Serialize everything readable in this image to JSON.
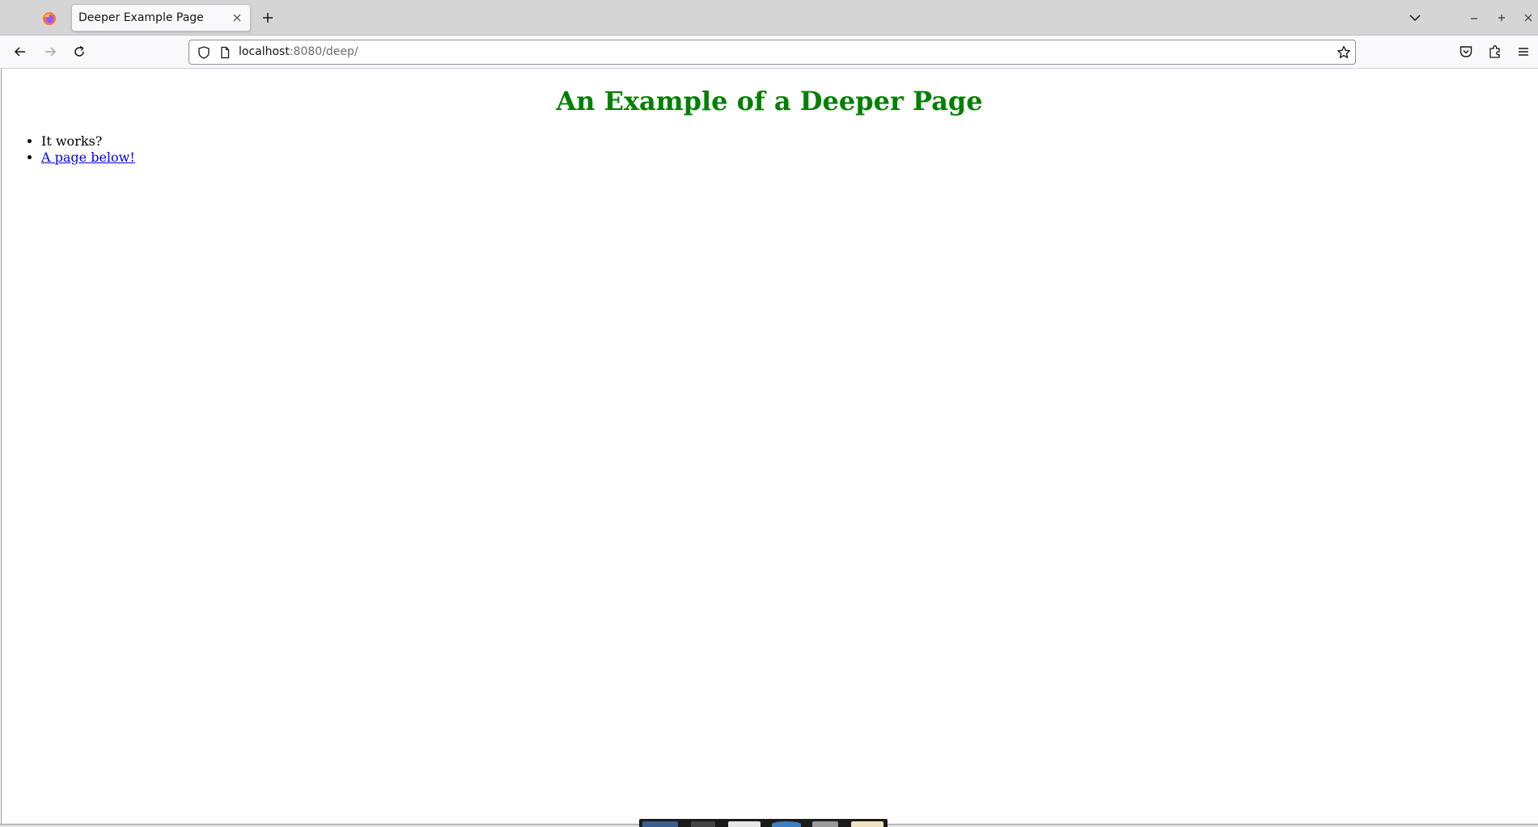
{
  "browser": {
    "tabs": [
      {
        "title": "Deeper Example Page",
        "active": true
      }
    ],
    "url": {
      "host": "localhost",
      "rest": ":8080/deep/"
    },
    "colors": {
      "tabbar": "#d5d5d5",
      "toolbar": "#f9f9fb",
      "link": "#0000ee",
      "heading": "#008000"
    },
    "icons": {
      "tab_favicon": "firefox-icon",
      "tab_close": "close-icon",
      "new_tab": "plus-icon",
      "list_tabs": "chevron-down-icon",
      "back": "arrow-left-icon",
      "forward": "arrow-right-icon",
      "reload": "reload-icon",
      "site_info": "shield-icon",
      "page": "page-icon",
      "bookmark": "star-icon",
      "pocket": "pocket-icon",
      "extensions": "puzzle-icon",
      "menu": "hamburger-menu-icon"
    }
  },
  "page": {
    "heading": "An Example of a Deeper Page",
    "items": [
      {
        "text": "It works?",
        "is_link": false
      },
      {
        "text": "A page below!",
        "is_link": true
      }
    ]
  }
}
